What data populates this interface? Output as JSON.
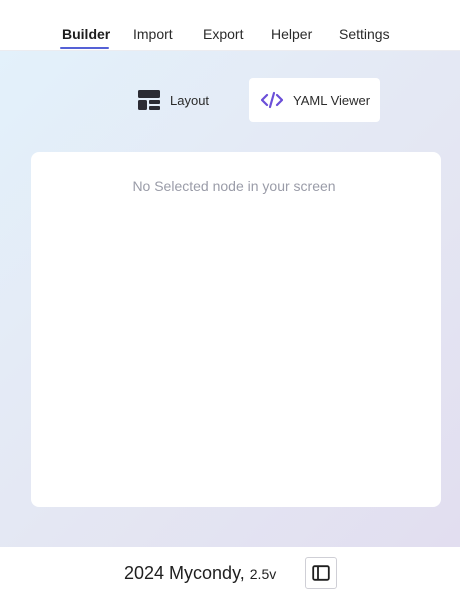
{
  "nav": {
    "tabs": [
      {
        "label": "Builder",
        "active": true
      },
      {
        "label": "Import",
        "active": false
      },
      {
        "label": "Export",
        "active": false
      },
      {
        "label": "Helper",
        "active": false
      },
      {
        "label": "Settings",
        "active": false
      }
    ],
    "accent_color": "#5561d6"
  },
  "view_switch": {
    "layout": {
      "label": "Layout",
      "icon": "layout-icon",
      "selected": false
    },
    "yaml": {
      "label": "YAML Viewer",
      "icon": "code-icon",
      "selected": true,
      "icon_color": "#6b4fd8"
    }
  },
  "panel": {
    "empty_message": "No Selected node in your screen"
  },
  "footer": {
    "brand": "2024 Mycondy,",
    "version": "2.5v",
    "toggle_icon": "sidebar-toggle-icon"
  }
}
